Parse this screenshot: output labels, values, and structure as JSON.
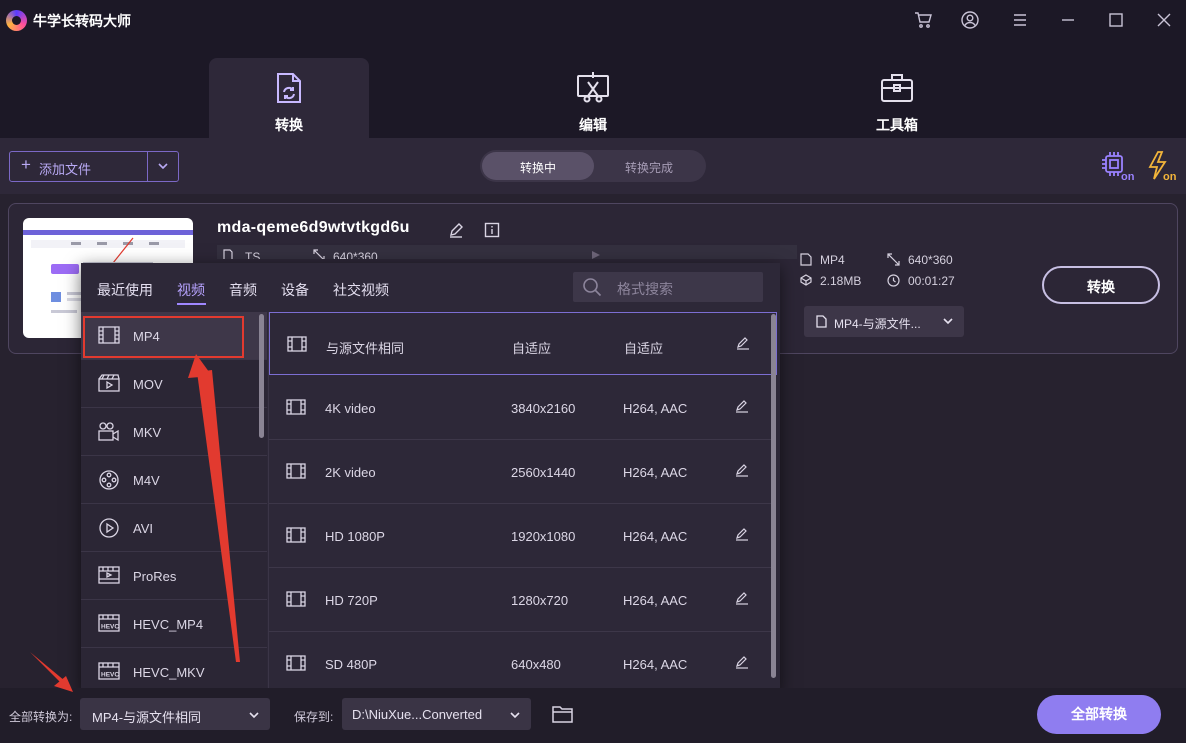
{
  "window": {
    "title": "牛学长转码大师"
  },
  "main_tabs": [
    {
      "label": "转换",
      "icon": "convert-icon"
    },
    {
      "label": "编辑",
      "icon": "edit-video-icon"
    },
    {
      "label": "工具箱",
      "icon": "toolbox-icon"
    }
  ],
  "toolbar": {
    "add_file_label": "添加文件"
  },
  "status_tabs": {
    "converting": "转换中",
    "completed": "转换完成"
  },
  "file": {
    "name": "mda-qeme6d9wtvtkgd6u",
    "source_format": "TS",
    "source_resolution": "640*360",
    "output_format": "MP4",
    "output_resolution": "640*360",
    "output_size": "2.18MB",
    "output_duration": "00:01:27",
    "format_select": "MP4-与源文件...",
    "convert_label": "转换"
  },
  "format_popup": {
    "tabs": [
      "最近使用",
      "视频",
      "音频",
      "设备",
      "社交视频"
    ],
    "active_tab": "视频",
    "search_placeholder": "格式搜索",
    "formats": [
      "MP4",
      "MOV",
      "MKV",
      "M4V",
      "AVI",
      "ProRes",
      "HEVC_MP4",
      "HEVC_MKV"
    ],
    "selected_format": "MP4",
    "presets": [
      {
        "name": "与源文件相同",
        "resolution": "自适应",
        "codec": "自适应"
      },
      {
        "name": "4K video",
        "resolution": "3840x2160",
        "codec": "H264, AAC"
      },
      {
        "name": "2K video",
        "resolution": "2560x1440",
        "codec": "H264, AAC"
      },
      {
        "name": "HD 1080P",
        "resolution": "1920x1080",
        "codec": "H264, AAC"
      },
      {
        "name": "HD 720P",
        "resolution": "1280x720",
        "codec": "H264, AAC"
      },
      {
        "name": "SD 480P",
        "resolution": "640x480",
        "codec": "H264, AAC"
      }
    ]
  },
  "bottom": {
    "convert_all_to_label": "全部转换为:",
    "convert_all_to_value": "MP4-与源文件相同",
    "save_to_label": "保存到:",
    "save_to_value": "D:\\NiuXue...Converted",
    "convert_all_button": "全部转换"
  },
  "colors": {
    "accent": "#9f87ff",
    "annotation": "#e23a2f",
    "background": "#27222f"
  }
}
